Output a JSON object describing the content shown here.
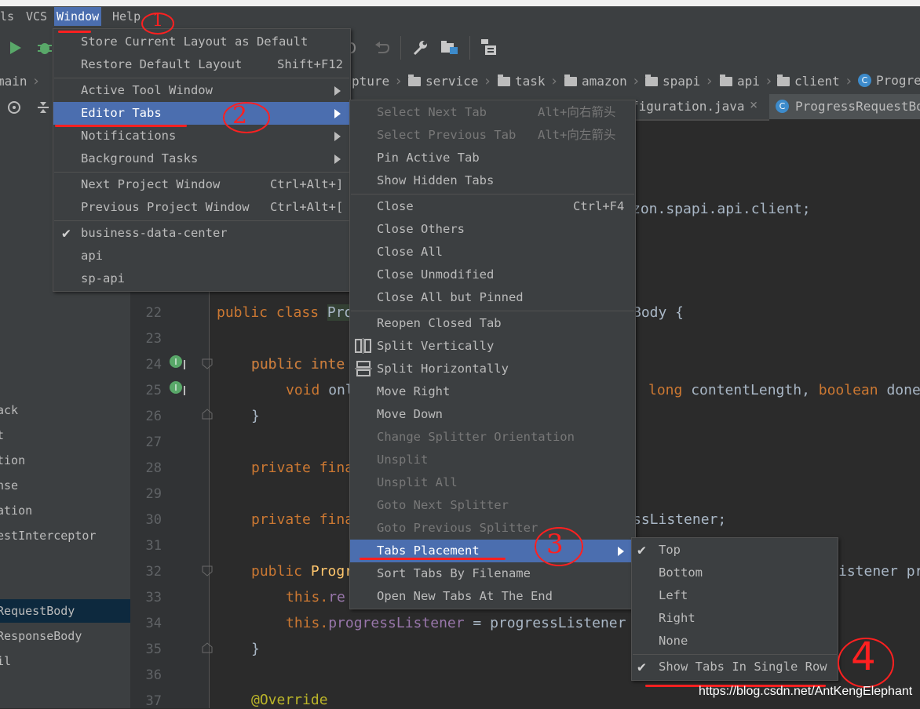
{
  "menubar": {
    "items": [
      "ls",
      "VCS",
      "Window",
      "Help"
    ]
  },
  "navbar": {
    "crumbs": [
      {
        "label": "main",
        "icon": "folder-icon"
      },
      {
        "label": "pture",
        "icon": "none"
      },
      {
        "label": "service",
        "icon": "folder-icon"
      },
      {
        "label": "task",
        "icon": "folder-icon"
      },
      {
        "label": "amazon",
        "icon": "folder-icon"
      },
      {
        "label": "spapi",
        "icon": "folder-icon"
      },
      {
        "label": "api",
        "icon": "folder-icon"
      },
      {
        "label": "client",
        "icon": "folder-icon"
      },
      {
        "label": "Progre",
        "icon": "class-icon"
      }
    ]
  },
  "tabs": [
    {
      "label": "figuration.java",
      "close": "×"
    },
    {
      "label": "ProgressRequestBod",
      "icon": "C"
    }
  ],
  "left_panel": {
    "items": [
      "ack",
      "t",
      "tion",
      "nse",
      "ation",
      "estInterceptor",
      "RequestBody",
      "ResponseBody",
      "il"
    ],
    "selected": "RequestBody"
  },
  "editor": {
    "line_numbers": [
      "22",
      "23",
      "24",
      "25",
      "26",
      "27",
      "28",
      "29",
      "30",
      "31",
      "32",
      "33",
      "34",
      "35",
      "36",
      "37"
    ],
    "package_tail": "zon.spapi.api.client;",
    "lines": {
      "l22_kw": "public class ",
      "l22_a": "Pro",
      "l22_b": "Body {",
      "l24_kw": "public inte",
      "l25_kw": "void ",
      "l25_a": "onl",
      "l25_b_kw": "long ",
      "l25_b": "contentLength, ",
      "l25_c_kw": "boolean ",
      "l25_c": "done",
      "l26": "}",
      "l28_kw": "private fina",
      "l30_kw": "private fina",
      "l30_b": "ssListener;",
      "l32_kw": "public ",
      "l32_a": "Progr",
      "l32_b": "istener pr",
      "l33_kw": "this.",
      "l33_a": "re",
      "l34_kw": "this.",
      "l34_fld": "progressListener",
      "l34_b": " = progressListener",
      "l35": "}",
      "l37": "@Override"
    }
  },
  "window_menu": {
    "items": [
      {
        "label": "Store Current Layout as Default",
        "shortcut": ""
      },
      {
        "label": "Restore Default Layout",
        "shortcut": "Shift+F12"
      },
      {
        "label": "Active Tool Window",
        "shortcut": ""
      },
      {
        "label": "Editor Tabs",
        "shortcut": ""
      },
      {
        "label": "Notifications",
        "shortcut": ""
      },
      {
        "label": "Background Tasks",
        "shortcut": ""
      },
      {
        "label": "Next Project Window",
        "shortcut": "Ctrl+Alt+]"
      },
      {
        "label": "Previous Project Window",
        "shortcut": "Ctrl+Alt+["
      },
      {
        "label": "business-data-center",
        "shortcut": ""
      },
      {
        "label": "api",
        "shortcut": ""
      },
      {
        "label": "sp-api",
        "shortcut": ""
      }
    ]
  },
  "editor_tabs_menu": {
    "items": [
      {
        "label": "Select Next Tab",
        "shortcut": "Alt+向右箭头"
      },
      {
        "label": "Select Previous Tab",
        "shortcut": "Alt+向左箭头"
      },
      {
        "label": "Pin Active Tab",
        "shortcut": ""
      },
      {
        "label": "Show Hidden Tabs",
        "shortcut": ""
      },
      {
        "label": "Close",
        "shortcut": "Ctrl+F4"
      },
      {
        "label": "Close Others",
        "shortcut": ""
      },
      {
        "label": "Close All",
        "shortcut": ""
      },
      {
        "label": "Close Unmodified",
        "shortcut": ""
      },
      {
        "label": "Close All but Pinned",
        "shortcut": ""
      },
      {
        "label": "Reopen Closed Tab",
        "shortcut": ""
      },
      {
        "label": "Split Vertically",
        "shortcut": ""
      },
      {
        "label": "Split Horizontally",
        "shortcut": ""
      },
      {
        "label": "Move Right",
        "shortcut": ""
      },
      {
        "label": "Move Down",
        "shortcut": ""
      },
      {
        "label": "Change Splitter Orientation",
        "shortcut": ""
      },
      {
        "label": "Unsplit",
        "shortcut": ""
      },
      {
        "label": "Unsplit All",
        "shortcut": ""
      },
      {
        "label": "Goto Next Splitter",
        "shortcut": ""
      },
      {
        "label": "Goto Previous Splitter",
        "shortcut": ""
      },
      {
        "label": "Tabs Placement",
        "shortcut": ""
      },
      {
        "label": "Sort Tabs By Filename",
        "shortcut": ""
      },
      {
        "label": "Open New Tabs At The End",
        "shortcut": ""
      }
    ]
  },
  "placement_menu": {
    "items": [
      {
        "label": "Top",
        "checked": true
      },
      {
        "label": "Bottom",
        "checked": false
      },
      {
        "label": "Left",
        "checked": false
      },
      {
        "label": "Right",
        "checked": false
      },
      {
        "label": "None",
        "checked": false
      },
      {
        "label": "Show Tabs In Single Row",
        "checked": true
      }
    ]
  },
  "annotations": {
    "n1": "1",
    "n2": "2",
    "n3": "3",
    "n4": "4"
  },
  "watermark": "https://blog.csdn.net/AntKengElephant",
  "colors": {
    "accent": "#4b6eaf",
    "annotation_red": "#ff2020",
    "keyword": "#cc7832"
  }
}
